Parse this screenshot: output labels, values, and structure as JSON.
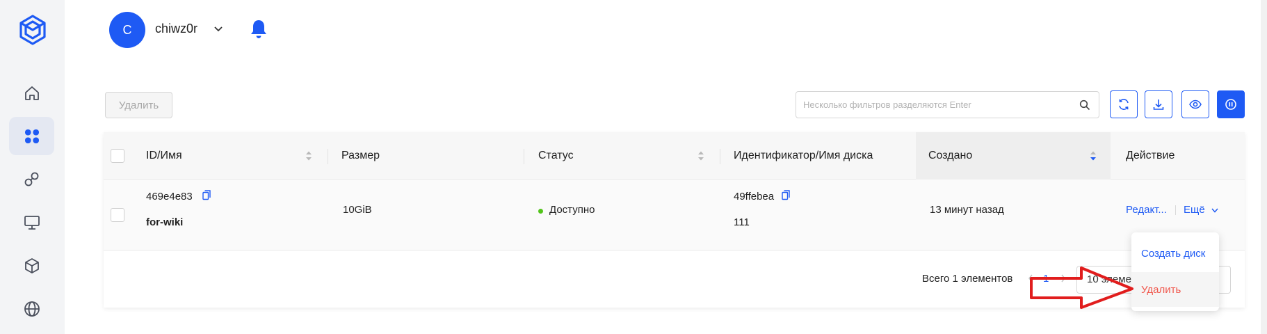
{
  "colors": {
    "accent": "#1e5af4",
    "danger": "#f0584d",
    "status_ok": "#52c41a",
    "annotation_arrow": "#e11d1d"
  },
  "sidebar": {
    "items": [
      {
        "icon": "home-icon"
      },
      {
        "icon": "apps-grid-icon",
        "active": true
      },
      {
        "icon": "network-icon"
      },
      {
        "icon": "monitor-icon"
      },
      {
        "icon": "cube-icon"
      },
      {
        "icon": "globe-icon"
      }
    ]
  },
  "header": {
    "avatar_letter": "C",
    "username": "chiwz0r"
  },
  "toolbar": {
    "delete_label": "Удалить",
    "search_placeholder": "Несколько фильтров разделяются Enter"
  },
  "table": {
    "columns": [
      "ID/Имя",
      "Размер",
      "Статус",
      "Идентификатор/Имя диска",
      "Создано",
      "Действие"
    ],
    "rows": [
      {
        "id": "469e4e83",
        "name": "for-wiki",
        "size": "10GiB",
        "status": "Доступно",
        "disk_id": "49ffebea",
        "disk_name": "111",
        "created": "13 минут назад",
        "action_edit": "Редакт...",
        "action_more": "Ещё"
      }
    ]
  },
  "pagination": {
    "total_text": "Всего 1 элементов",
    "current_page": "1",
    "page_size_text": "10 элеме"
  },
  "dropdown": {
    "create_disk": "Создать диск",
    "delete": "Удалить"
  }
}
